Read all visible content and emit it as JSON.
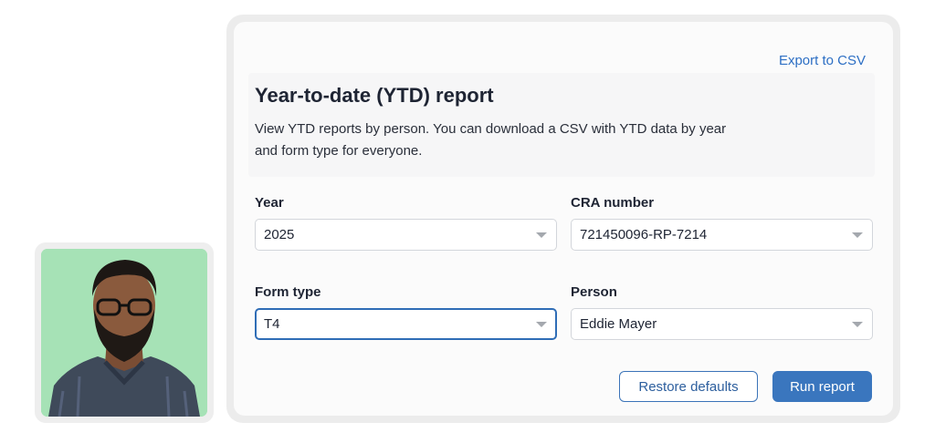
{
  "header": {
    "export_label": "Export to CSV",
    "title": "Year-to-date (YTD) report",
    "description": "View YTD reports by person. You can download a CSV with YTD data by year and form type for everyone."
  },
  "fields": {
    "year": {
      "label": "Year",
      "value": "2025"
    },
    "cra_number": {
      "label": "CRA number",
      "value": "721450096-RP-7214"
    },
    "form_type": {
      "label": "Form type",
      "value": "T4"
    },
    "person": {
      "label": "Person",
      "value": "Eddie Mayer"
    }
  },
  "actions": {
    "restore_label": "Restore defaults",
    "run_label": "Run report"
  },
  "icons": {
    "select_chevron": "chevron-down-icon",
    "avatar": "user-photo"
  },
  "colors": {
    "accent": "#3a76be",
    "link": "#2d6fc4",
    "avatar_bg": "#a6e2b6",
    "panel_bg": "#fbfbfb"
  }
}
